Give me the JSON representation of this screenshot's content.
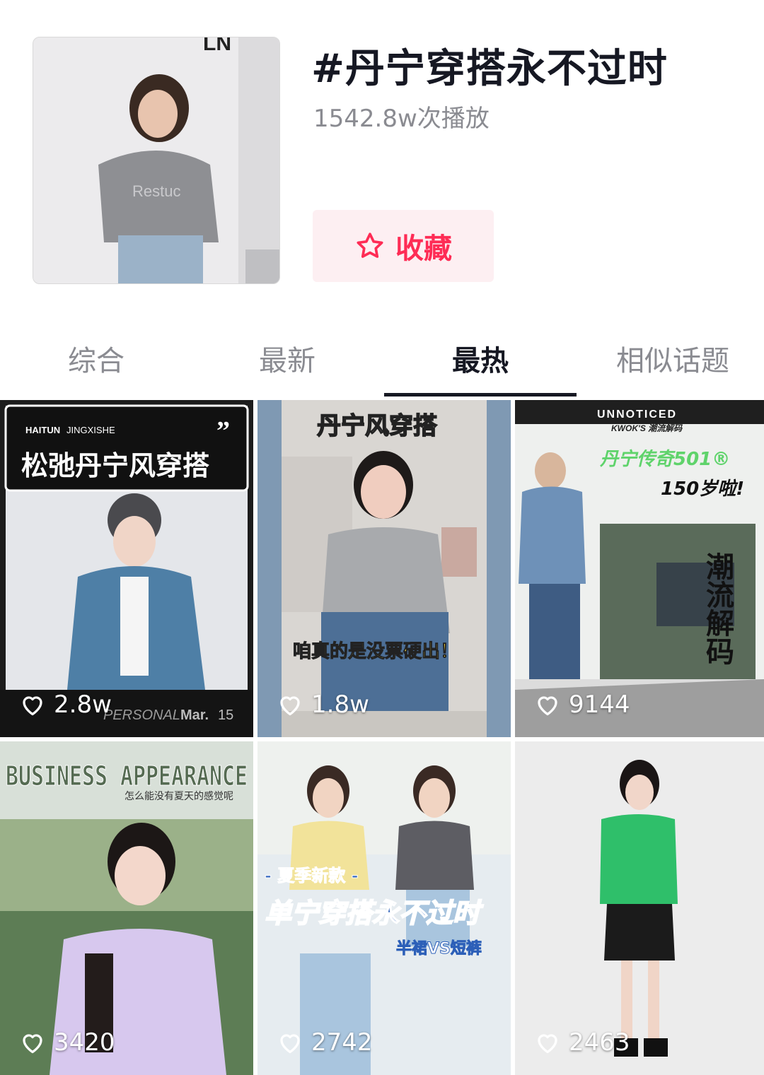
{
  "topic": {
    "title": "#丹宁穿搭永不过时",
    "plays": "1542.8w次播放",
    "cover_sign": "LN",
    "cover_shirt": "Restuc",
    "favorite_label": "收藏"
  },
  "tabs": [
    {
      "label": "综合",
      "active": false
    },
    {
      "label": "最新",
      "active": false
    },
    {
      "label": "最热",
      "active": true
    },
    {
      "label": "相似话题",
      "active": false
    }
  ],
  "videos": [
    {
      "likes": "2.8w",
      "caption": "松弛丹宁风穿搭",
      "brand": "HAITUN",
      "brand_sub": "JINGXISHE",
      "quote": "”",
      "footer_a": "PERSONAL",
      "footer_b": "Mar.",
      "footer_c": "15"
    },
    {
      "likes": "1.8w",
      "caption": "丹宁风穿搭",
      "subtitle": "咱真的是没票硬出！"
    },
    {
      "likes": "9144",
      "header": "UNNOTICED",
      "brand": "KWOK'S 潮流解码",
      "line1": "丹宁传奇501®",
      "line2": "150岁啦!",
      "vertical": "潮流解码"
    },
    {
      "likes": "3420",
      "caption": "BUSINESS APPEARANCE",
      "sub": "怎么能没有夏天的感觉呢"
    },
    {
      "likes": "2742",
      "tag": "- 夏季新款 -",
      "caption": "单宁穿搭永不过时",
      "sub": "半裙VS短裤"
    },
    {
      "likes": "2463"
    }
  ],
  "colors": {
    "accent": "#fe2c55",
    "fav_bg": "#fdeff2",
    "text_primary": "#161823",
    "text_secondary": "#8a8b91"
  }
}
